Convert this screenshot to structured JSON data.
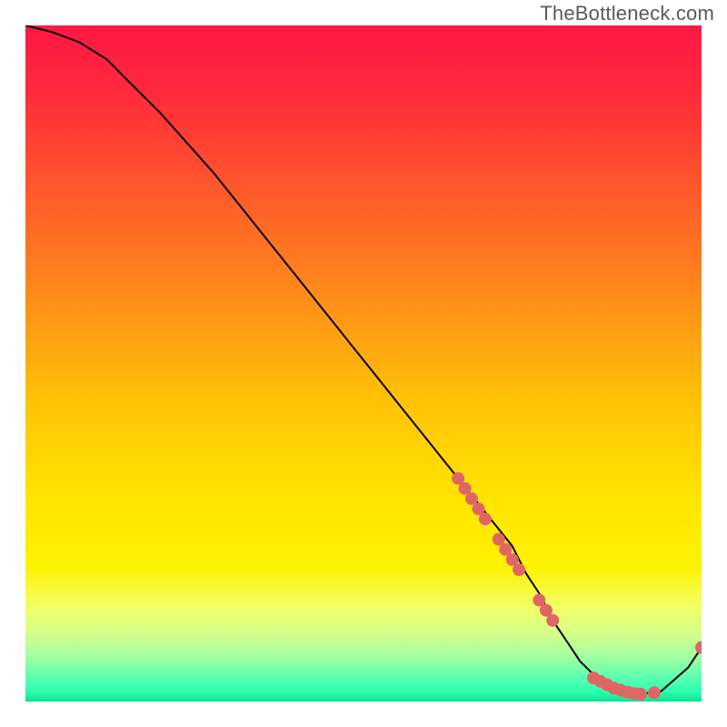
{
  "watermark": "TheBottleneck.com",
  "chart_data": {
    "type": "line",
    "title": "",
    "xlabel": "",
    "ylabel": "",
    "xlim": [
      0,
      100
    ],
    "ylim": [
      0,
      100
    ],
    "series": [
      {
        "name": "curve",
        "x": [
          0,
          4,
          8,
          12,
          16,
          20,
          24,
          28,
          32,
          36,
          40,
          44,
          48,
          52,
          56,
          60,
          64,
          68,
          72,
          74,
          76,
          78,
          80,
          82,
          84,
          86,
          88,
          90,
          94,
          98,
          100
        ],
        "y": [
          100,
          99,
          97.5,
          95,
          91,
          87,
          82.5,
          78,
          73,
          68,
          63,
          58,
          53,
          48,
          43,
          38,
          33,
          28,
          23,
          19,
          16,
          12,
          9,
          6,
          4,
          2.5,
          1.5,
          1,
          1.5,
          5,
          8
        ],
        "stroke": "#000000",
        "stroke_width": 2
      }
    ],
    "scatter": [
      {
        "name": "dots-descending",
        "color": "#e06666",
        "radius": 7,
        "points": [
          {
            "x": 64,
            "y": 33
          },
          {
            "x": 65,
            "y": 31.5
          },
          {
            "x": 66,
            "y": 30
          },
          {
            "x": 67,
            "y": 28.5
          },
          {
            "x": 68,
            "y": 27
          },
          {
            "x": 70,
            "y": 24
          },
          {
            "x": 71,
            "y": 22.5
          },
          {
            "x": 72,
            "y": 21
          },
          {
            "x": 73,
            "y": 19.5
          },
          {
            "x": 76,
            "y": 15
          },
          {
            "x": 77,
            "y": 13.5
          },
          {
            "x": 78,
            "y": 12
          }
        ]
      },
      {
        "name": "dots-bottom",
        "color": "#e06666",
        "radius": 7,
        "points": [
          {
            "x": 84,
            "y": 3.5
          },
          {
            "x": 85,
            "y": 3
          },
          {
            "x": 86,
            "y": 2.5
          },
          {
            "x": 87,
            "y": 2
          },
          {
            "x": 88,
            "y": 1.7
          },
          {
            "x": 89,
            "y": 1.4
          },
          {
            "x": 90,
            "y": 1.2
          },
          {
            "x": 91,
            "y": 1.1
          },
          {
            "x": 93,
            "y": 1.3
          },
          {
            "x": 100,
            "y": 8
          }
        ]
      }
    ],
    "gradient_stops": [
      {
        "pos": 0.0,
        "color": "#ff1744"
      },
      {
        "pos": 0.1,
        "color": "#ff2a3c"
      },
      {
        "pos": 0.25,
        "color": "#ff5a2a"
      },
      {
        "pos": 0.4,
        "color": "#ff8c1a"
      },
      {
        "pos": 0.55,
        "color": "#ffc107"
      },
      {
        "pos": 0.7,
        "color": "#ffe400"
      },
      {
        "pos": 0.8,
        "color": "#fff200"
      },
      {
        "pos": 0.86,
        "color": "#f2ff66"
      },
      {
        "pos": 0.9,
        "color": "#d4ff8a"
      },
      {
        "pos": 0.93,
        "color": "#a8ff9e"
      },
      {
        "pos": 0.96,
        "color": "#66ffb0"
      },
      {
        "pos": 0.985,
        "color": "#2effb0"
      },
      {
        "pos": 1.0,
        "color": "#09e38e"
      }
    ]
  }
}
